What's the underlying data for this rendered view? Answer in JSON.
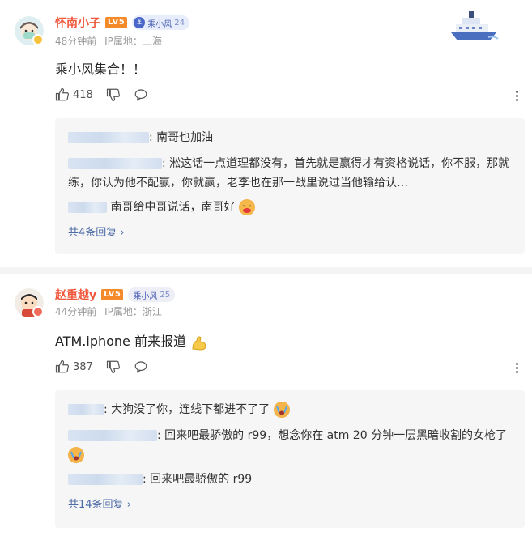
{
  "comments": [
    {
      "username": "怀南小子",
      "level": "LV5",
      "fan_badge": "乘小风",
      "fan_level": "24",
      "time": "48分钟前",
      "location_label": "IP属地：",
      "location": "上海",
      "text": "乘小风集合！！",
      "likes": "418",
      "replies": [
        {
          "text": "南哥也加油"
        },
        {
          "text": "淞这话一点道理都没有，首先就是赢得才有资格说话，你不服，那就练，你认为他不配赢，你就赢，老李也在那一战里说过当他输给认…"
        },
        {
          "text": "南哥给中哥说话，南哥好"
        }
      ],
      "more_replies": "共4条回复 ›"
    },
    {
      "username": "赵重越y",
      "level": "LV5",
      "fan_badge": "乘小风",
      "fan_level": "25",
      "time": "44分钟前",
      "location_label": "IP属地：",
      "location": "浙江",
      "text": "ATM.iphone 前来报道",
      "likes": "387",
      "replies": [
        {
          "text": "大狗没了你，连线下都进不了了"
        },
        {
          "text": "回来吧最骄傲的 r99，想念你在 atm 20 分钟一层黑暗收割的女枪了"
        },
        {
          "text": "回来吧最骄傲的 r99"
        }
      ],
      "more_replies": "共14条回复 ›"
    }
  ],
  "colors": {
    "username": "#f0573b",
    "link": "#4c6aa6",
    "level_badge": "#f58a2a"
  },
  "icons": [
    "like-icon",
    "dislike-icon",
    "reply-icon",
    "more-icon",
    "ship-badge-icon",
    "emoji"
  ]
}
